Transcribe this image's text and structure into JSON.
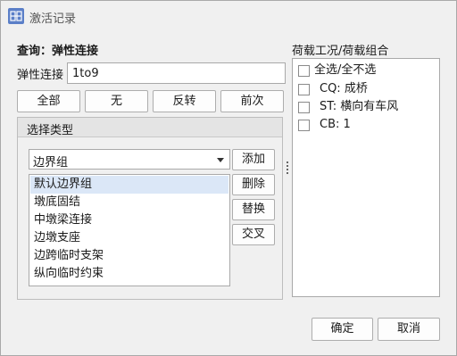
{
  "window": {
    "title": "激活记录"
  },
  "query": {
    "label": "查询：弹性连接"
  },
  "elastic": {
    "label": "弹性连接",
    "value": "1to9"
  },
  "buttons": {
    "all": "全部",
    "none": "无",
    "invert": "反转",
    "previous": "前次"
  },
  "select_type": {
    "title": "选择类型",
    "combo_value": "边界组",
    "items": [
      "默认边界组",
      "墩底固结",
      "中墩梁连接",
      "边墩支座",
      "边跨临时支架",
      "纵向临时约束"
    ],
    "selected_index": 0,
    "actions": {
      "add": "添加",
      "delete": "删除",
      "replace": "替换",
      "intersect": "交叉"
    }
  },
  "loads": {
    "title": "荷载工况/荷载组合",
    "select_all": "全选/全不选",
    "items": [
      "CQ: 成桥",
      "ST: 横向有车风",
      "CB: 1"
    ]
  },
  "dialog": {
    "ok": "确定",
    "cancel": "取消"
  }
}
